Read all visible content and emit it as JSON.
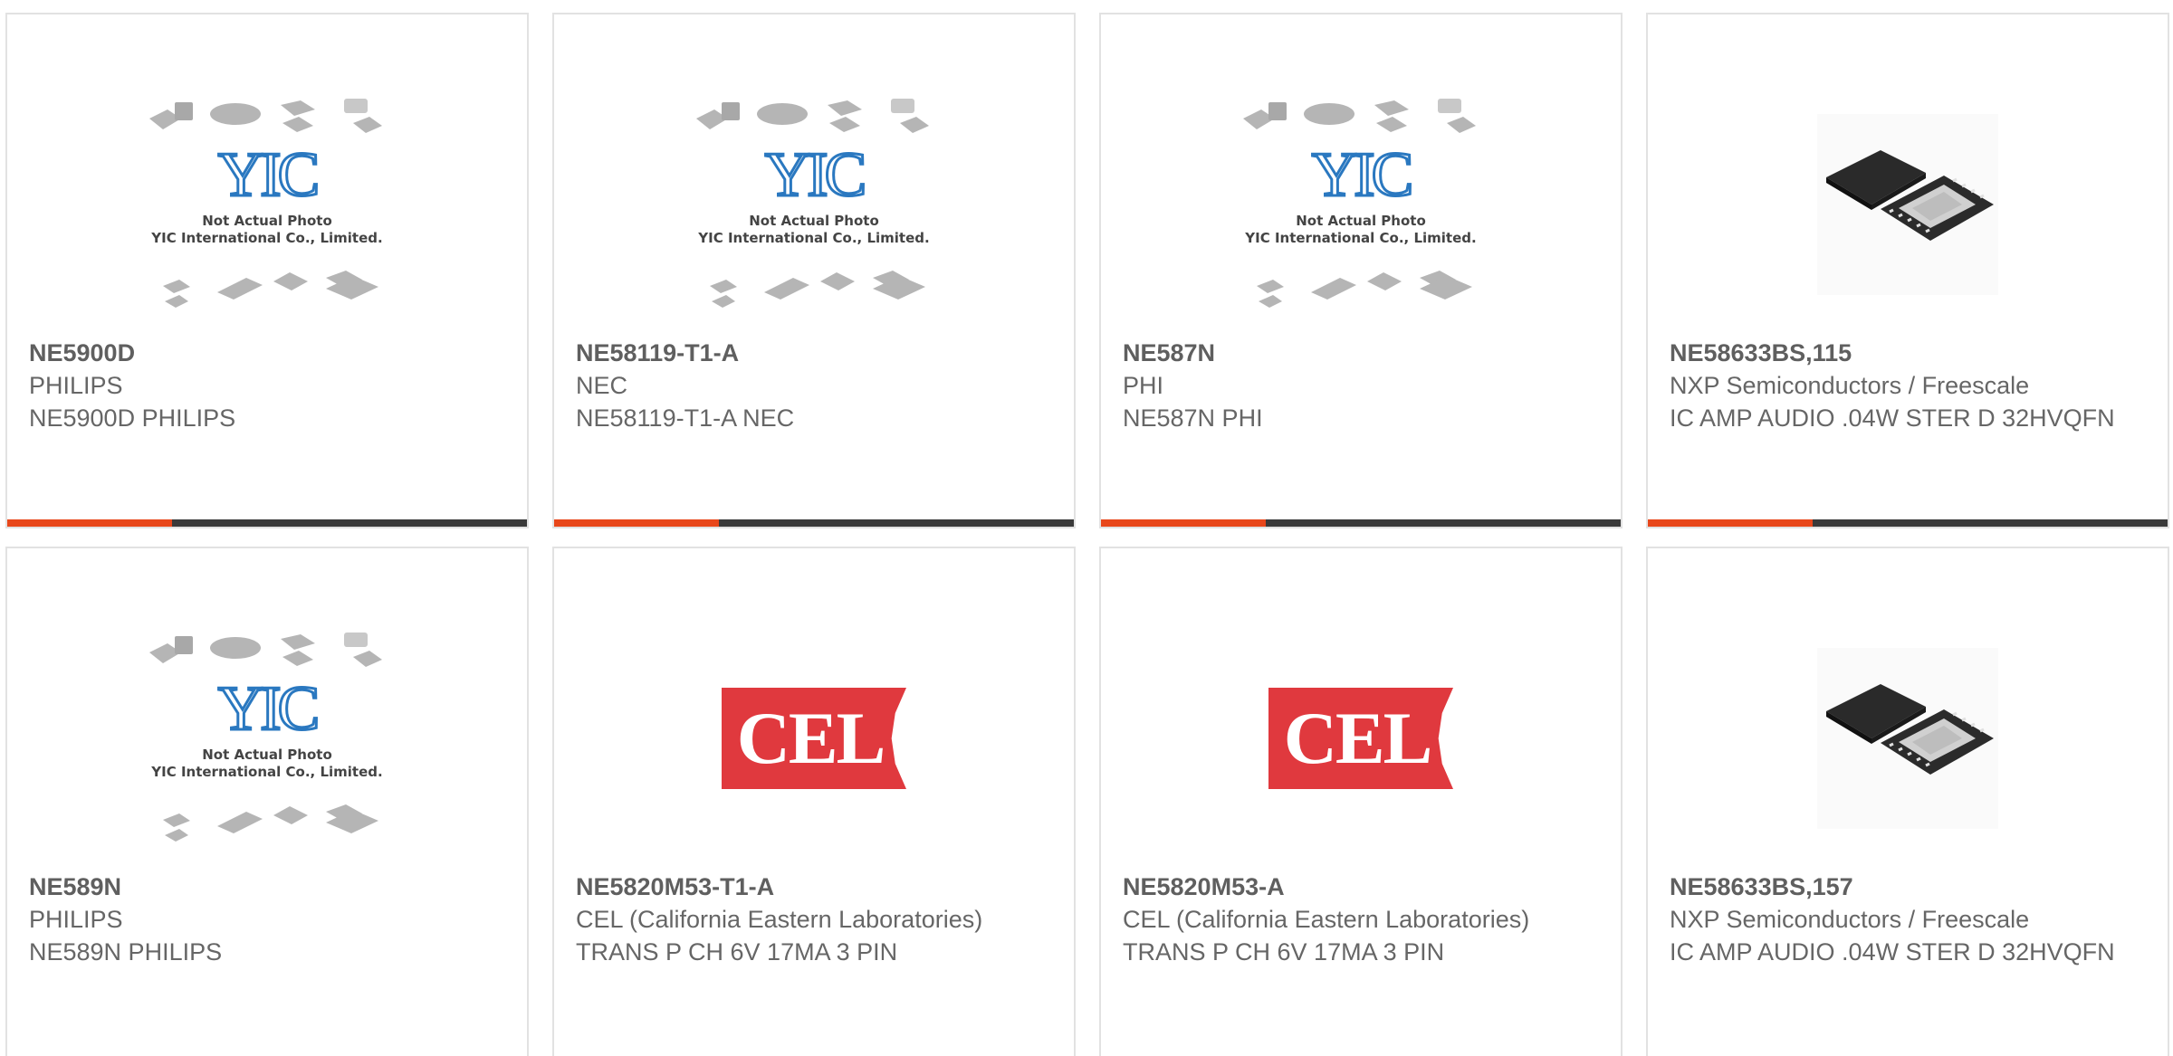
{
  "products": [
    {
      "part_number": "NE5900D",
      "manufacturer": "PHILIPS",
      "description": "NE5900D PHILIPS",
      "image": "yic-placeholder"
    },
    {
      "part_number": "NE58119-T1-A",
      "manufacturer": "NEC",
      "description": "NE58119-T1-A NEC",
      "image": "yic-placeholder"
    },
    {
      "part_number": "NE587N",
      "manufacturer": "PHI",
      "description": "NE587N PHI",
      "image": "yic-placeholder"
    },
    {
      "part_number": "NE58633BS,115",
      "manufacturer": "NXP Semiconductors / Freescale",
      "description": "IC AMP AUDIO .04W STER D 32HVQFN",
      "image": "qfn-chip-photo"
    },
    {
      "part_number": "NE589N",
      "manufacturer": "PHILIPS",
      "description": "NE589N PHILIPS",
      "image": "yic-placeholder"
    },
    {
      "part_number": "NE5820M53-T1-A",
      "manufacturer": "CEL (California Eastern Laboratories)",
      "description": "TRANS P CH 6V 17MA 3 PIN",
      "image": "cel-logo"
    },
    {
      "part_number": "NE5820M53-A",
      "manufacturer": "CEL (California Eastern Laboratories)",
      "description": "TRANS P CH 6V 17MA 3 PIN",
      "image": "cel-logo"
    },
    {
      "part_number": "NE58633BS,157",
      "manufacturer": "NXP Semiconductors / Freescale",
      "description": "IC AMP AUDIO .04W STER D 32HVQFN",
      "image": "qfn-chip-photo"
    }
  ],
  "placeholder": {
    "logo_text": "YIC",
    "caption_line1": "Not Actual Photo",
    "caption_line2": "YIC International Co., Limited."
  },
  "cel_logo_text": "CEL",
  "colors": {
    "accent": "#e8471b",
    "bar": "#3a3a3a",
    "text": "#666666",
    "border": "#e2e2e2",
    "yic_blue": "#2a78c0",
    "cel_red": "#e0393e"
  }
}
